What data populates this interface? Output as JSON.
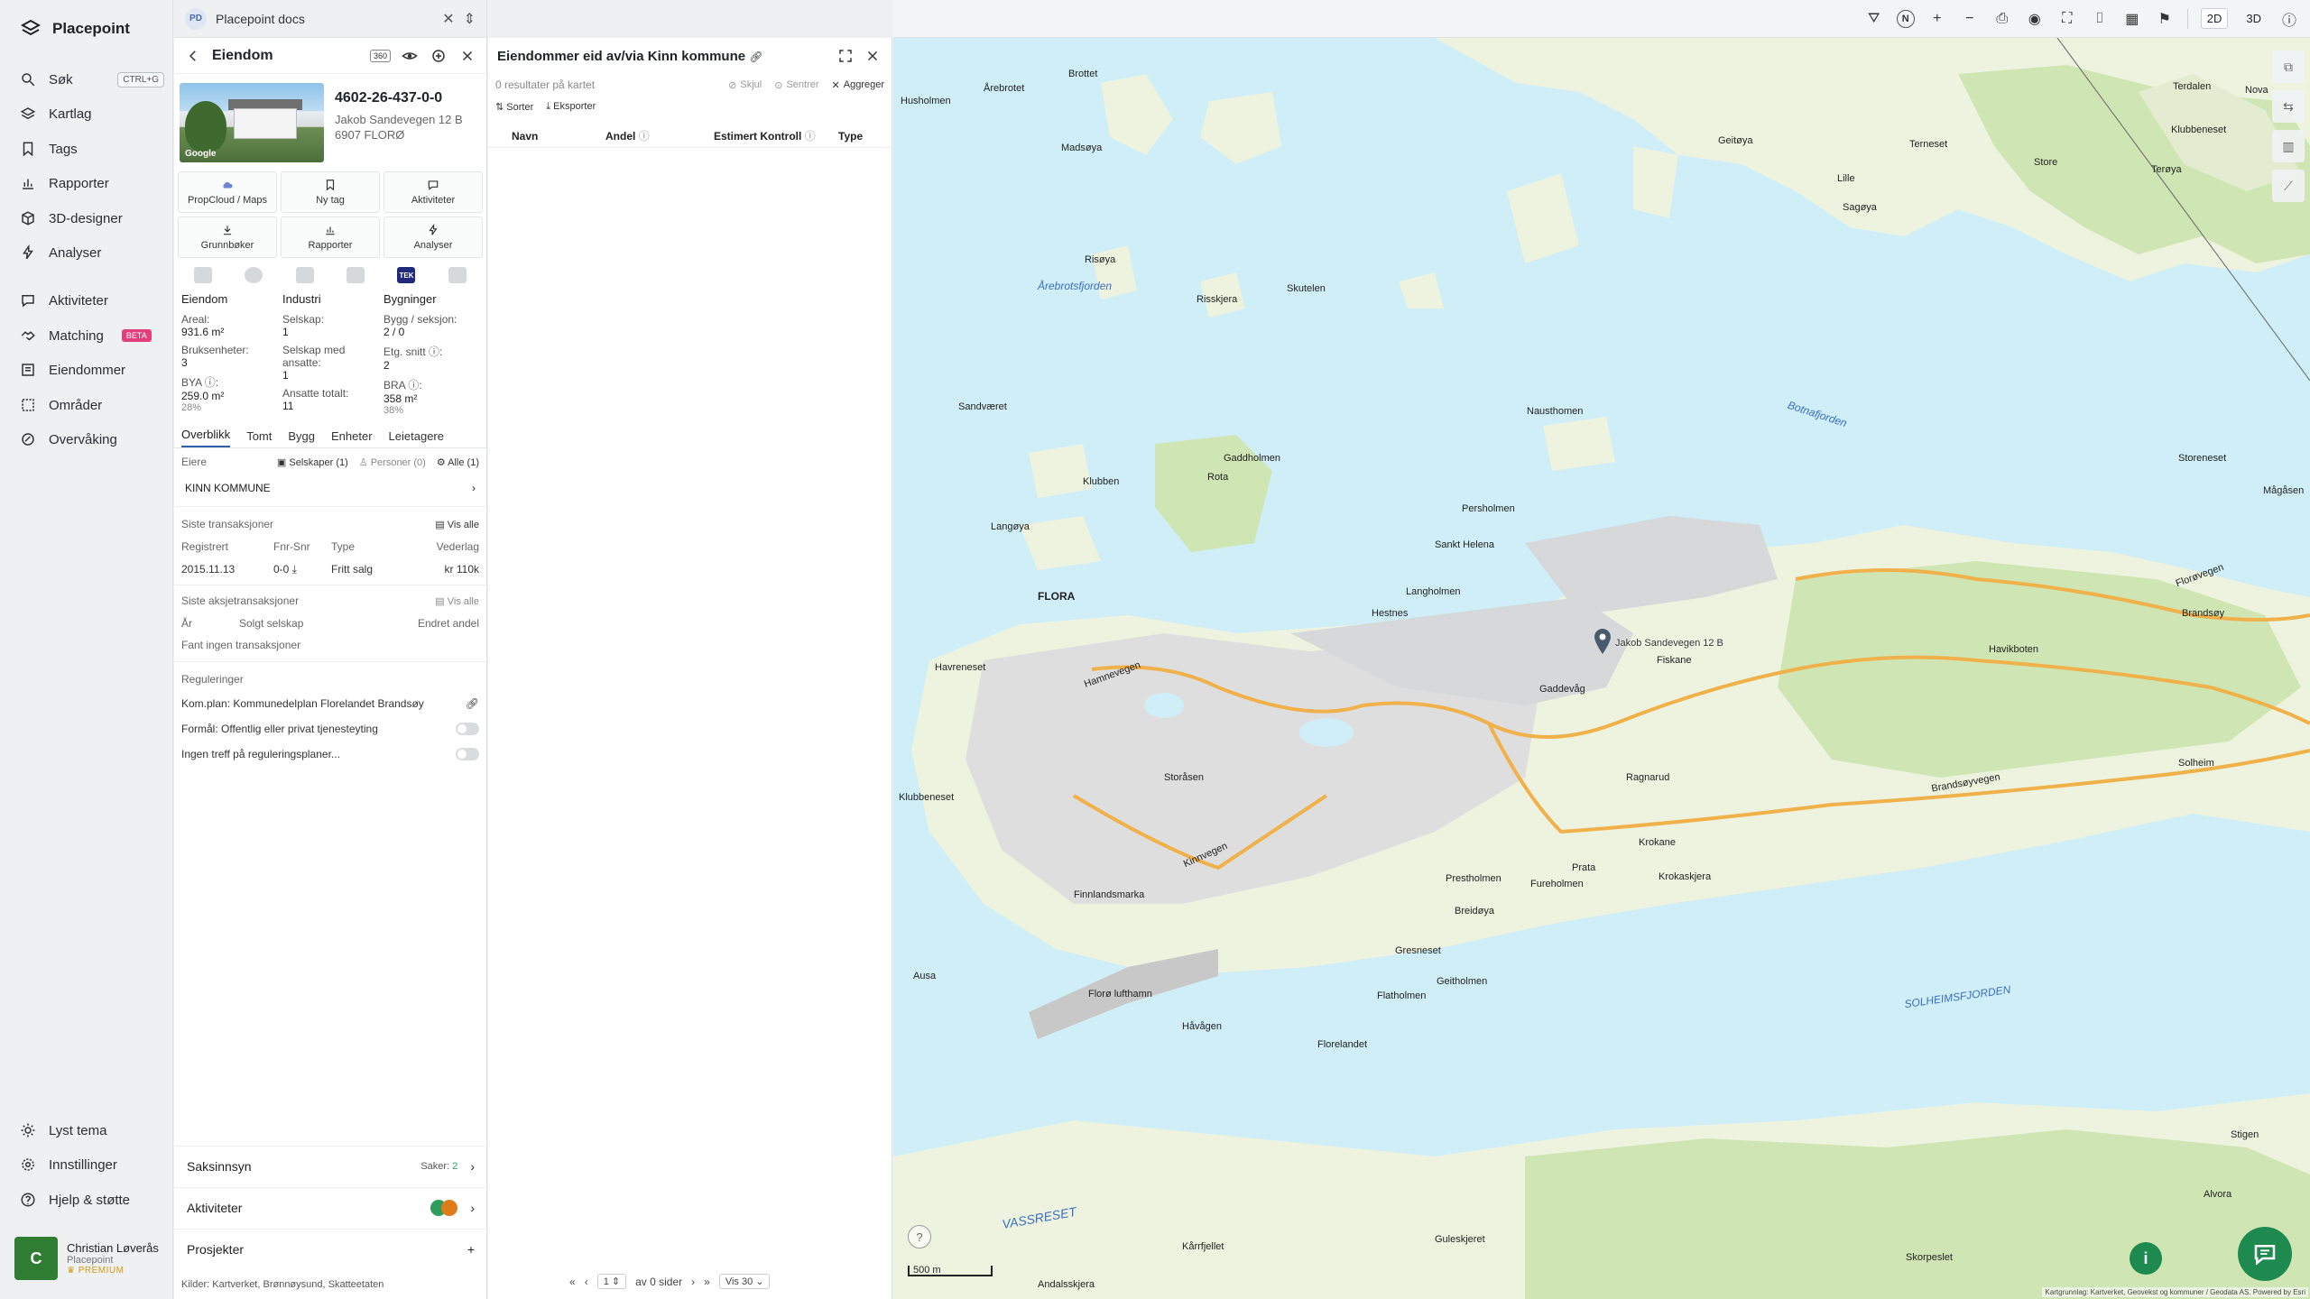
{
  "app": {
    "brand": "Placepoint",
    "nav": [
      {
        "label": "Søk",
        "shortcut": "CTRL+G",
        "icon": "search-icon"
      },
      {
        "label": "Kartlag",
        "icon": "layers-icon"
      },
      {
        "label": "Tags",
        "icon": "bookmark-icon"
      },
      {
        "label": "Rapporter",
        "icon": "chart-icon"
      },
      {
        "label": "3D-designer",
        "icon": "cube-icon"
      },
      {
        "label": "Analyser",
        "icon": "bolt-icon"
      },
      {
        "label": "Aktiviteter",
        "icon": "chat-icon"
      },
      {
        "label": "Matching",
        "badge": "BETA",
        "icon": "handshake-icon"
      },
      {
        "label": "Eiendommer",
        "icon": "list-icon"
      },
      {
        "label": "Områder",
        "icon": "area-icon"
      },
      {
        "label": "Overvåking",
        "icon": "monitor-icon"
      }
    ],
    "bottom_nav": [
      {
        "label": "Lyst tema",
        "icon": "sun-icon"
      },
      {
        "label": "Innstillinger",
        "icon": "gear-icon"
      },
      {
        "label": "Hjelp & støtte",
        "icon": "help-icon"
      }
    ],
    "user": {
      "initial": "C",
      "name": "Christian Løverås",
      "org": "Placepoint",
      "tier": "PREMIUM"
    }
  },
  "doc_tab": {
    "badge": "PD",
    "title": "Placepoint docs"
  },
  "property": {
    "header": "Eiendom",
    "tag_box": "360",
    "id": "4602-26-437-0-0",
    "address_line1": "Jakob Sandevegen 12 B",
    "address_line2": "6907 FLORØ",
    "photo_label": "Google",
    "actions": [
      "PropCloud / Maps",
      "Ny tag",
      "Aktiviteter",
      "Grunnbøker",
      "Rapporter",
      "Analyser"
    ],
    "source_tek": "TEK",
    "stats": {
      "col1_head": "Eiendom",
      "col2_head": "Industri",
      "col3_head": "Bygninger",
      "areal_k": "Areal:",
      "areal_v": "931.6 m²",
      "bruks_k": "Bruksenheter:",
      "bruks_v": "3",
      "bya_k": "BYA ⓘ:",
      "bya_v": "259.0 m²",
      "bya_p": "28%",
      "selskap_k": "Selskap:",
      "selskap_v": "1",
      "selskap_ans_k": "Selskap med ansatte:",
      "selskap_ans_v": "1",
      "ansatte_k": "Ansatte totalt:",
      "ansatte_v": "11",
      "bygg_k": "Bygg / seksjon:",
      "bygg_v": "2 / 0",
      "etg_k": "Etg. snitt ⓘ:",
      "etg_v": "2",
      "bra_k": "BRA ⓘ:",
      "bra_v": "358 m²",
      "bra_p": "38%"
    },
    "subtabs": [
      "Overblikk",
      "Tomt",
      "Bygg",
      "Enheter",
      "Leietagere"
    ],
    "owners_label": "Eiere",
    "owner_filters": [
      "Selskaper (1)",
      "Personer (0)",
      "Alle (1)"
    ],
    "owner": "KINN KOMMUNE",
    "transactions": {
      "title": "Siste transaksjoner",
      "link": "Vis alle",
      "cols": [
        "Registrert",
        "Fnr-Snr",
        "Type",
        "Vederlag"
      ],
      "row": {
        "date": "2015.11.13",
        "fnr": "0-0",
        "type": "Fritt salg",
        "price": "kr 110k"
      }
    },
    "share_tx": {
      "title": "Siste aksjetransaksjoner",
      "link": "Vis alle",
      "cols": [
        "År",
        "Solgt selskap",
        "Endret andel"
      ],
      "empty": "Fant ingen transaksjoner"
    },
    "regulations": {
      "title": "Reguleringer",
      "plan": "Kom.plan: Kommunedelplan Florelandet Brandsøy",
      "purpose": "Formål: Offentlig eller privat tjenesteyting",
      "none": "Ingen treff på reguleringsplaner..."
    },
    "saksinnsyn": {
      "label": "Saksinnsyn",
      "count_label": "Saker:",
      "count": "2"
    },
    "aktiviteter": {
      "label": "Aktiviteter"
    },
    "prosjekter": {
      "label": "Prosjekter"
    },
    "sources": "Kilder:  Kartverket,  Brønnøysund,  Skatteetaten"
  },
  "results": {
    "title": "Eiendommer eid av/via Kinn kommune",
    "count_text": "0 resultater på kartet",
    "tools": [
      "Skjul",
      "Sentrer",
      "Aggreger"
    ],
    "sort": "Sorter",
    "export": "Eksporter",
    "cols": [
      "Navn",
      "Andel",
      "Estimert Kontroll",
      "Type"
    ],
    "pager": {
      "page": "1",
      "of": "av 0 sider",
      "per": "Vis 30"
    }
  },
  "map": {
    "toolbar": {
      "mode_2d": "2D",
      "mode_3d": "3D",
      "north": "N"
    },
    "labels": {
      "florø": "FLORA",
      "pin_address": "Jakob Sandevegen 12 B",
      "solheims": "SOLHEIMSFJORDEN",
      "botnafjorden": "Botnafjorden",
      "arebrotsfjorden": "Årebrotsfjorden",
      "vassreset": "VASSRESET",
      "kinnvegen": "Kinnvegen",
      "brandsoyvegen": "Brandsøyvegen",
      "floroyvegen": "Florøvegen",
      "hamnevegen": "Hamnevegen",
      "florlufthamn": "Florø lufthamn",
      "brandsoy": "Brandsøy",
      "sandvaeret": "Sandværet",
      "rota": "Rota",
      "risoya": "Risøya",
      "skutelen": "Skutelen",
      "risskjera": "Risskjera",
      "gaddholmen": "Gaddholmen",
      "persholmen": "Persholmen",
      "langholmen": "Langholmen",
      "hestnes": "Hestnes",
      "terdalen": "Terdalen",
      "nova": "Nova",
      "store": "Store",
      "teroya": "Terøya",
      "lille": "Lille",
      "storeneset": "Storeneset",
      "magasen": "Mågåsen",
      "havikboten": "Havikboten",
      "fureholmen": "Fureholmen",
      "prestholmen": "Prestholmen",
      "krokane": "Krokane",
      "krokaskjera": "Krokaskjera",
      "prata": "Prata",
      "breidoya": "Breidøya",
      "gresneset": "Gresneset",
      "geitholmen": "Geitholmen",
      "flatholmen": "Flatholmen",
      "florelandet": "Florelandet",
      "havagen": "Håvågen",
      "finnlandsmarka": "Finnlandsmarka",
      "storasen": "Storåsen",
      "solheim": "Solheim",
      "ausa": "Ausa",
      "alvora": "Alvora",
      "stigen": "Stigen",
      "skorpeslet": "Skorpeslet",
      "guleskjeret": "Guleskjeret",
      "andalsskjera": "Andalsskjera",
      "karrfjellet": "Kårrfjellet",
      "klubbeneset": "Klubbeneset",
      "havreneset": "Havreneset",
      "langoya": "Langøya",
      "klubben": "Klubben",
      "nausthomen": "Nausthomen",
      "sankthelena": "Sankt Helena",
      "gaddevag": "Gaddevåg",
      "fiskane": "Fiskane",
      "ragnarud": "Ragnarud",
      "aresbrotet": "Årebrotet",
      "brottet": "Brottet",
      "husholmen": "Husholmen",
      "madsaya": "Madsøya",
      "geitoya": "Geitøya",
      "terneset": "Terneset",
      "sagoya": "Sagøya",
      "klubbeneset2": "Klubbeneset"
    },
    "scale": "500 m",
    "attribution": "Kartgrunnlag: Kartverket, Geovekst og kommuner / Geodata AS. Powered by Esri",
    "colors": {
      "water": "#cfeef8",
      "land": "#eef3df",
      "forest": "#cfe6b4",
      "urban": "#dedede",
      "road": "#f0b04a"
    }
  }
}
